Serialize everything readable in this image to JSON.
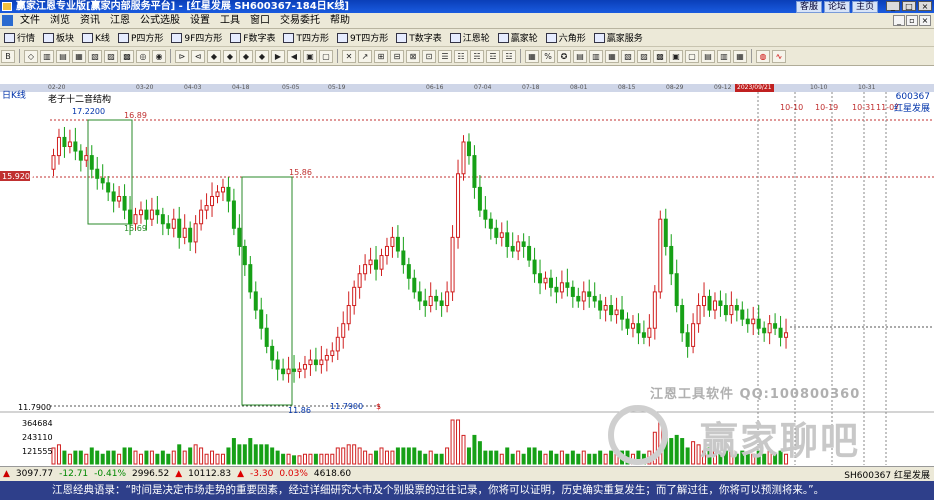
{
  "window": {
    "title": "赢家江恩专业版[赢家内部服务平台] - [红星发展  SH600367-184日K线]",
    "top_links": [
      "客服",
      "论坛",
      "主页"
    ]
  },
  "menu": [
    "文件",
    "浏览",
    "资讯",
    "江恩",
    "公式选股",
    "设置",
    "工具",
    "窗口",
    "交易委托",
    "帮助"
  ],
  "toolbar1": [
    "行情",
    "板块",
    "K线",
    "P四方形",
    "9F四方形",
    "F数字表",
    "T四方形",
    "9T四方形",
    "T数字表",
    "江恩轮",
    "赢家轮",
    "六角形",
    "赢家服务"
  ],
  "dates": [
    "02-20",
    "03-20",
    "04-03",
    "04-18",
    "05-05",
    "05-19",
    "06-16",
    "07-04",
    "07-18",
    "08-01",
    "08-15",
    "08-29",
    "09-12",
    "2023/09/21",
    "10-10",
    "10-31"
  ],
  "chart": {
    "period_label": "日K线",
    "indicator_label": "老子十二音结构",
    "stock_code": "600367",
    "stock_name": "红星发展",
    "high_tag": "17.2200",
    "level_1689": "16.89",
    "left_price": "15.9202",
    "level_1586": "15.86",
    "level_1569": "15.69",
    "low_left": "11.7900",
    "low_tag": "11.7900",
    "low_val": "11.86",
    "dollar": "$",
    "future_dates": [
      "10-10",
      "10-19",
      "10-31",
      "11-07"
    ],
    "volume_ticks": [
      "364684",
      "243110",
      "121555"
    ]
  },
  "chart_data": {
    "type": "candlestick",
    "title": "",
    "stock": "红星发展 600367",
    "high": 17.22,
    "low": 11.79,
    "levels": [
      16.89,
      15.86,
      15.69,
      15.9202
    ],
    "ylim": [
      11.0,
      18.0
    ],
    "volume_ticks": [
      364684,
      243110,
      121555
    ],
    "closes": [
      16.6,
      17.0,
      16.8,
      16.9,
      16.7,
      16.5,
      16.6,
      16.3,
      16.1,
      16.0,
      15.8,
      15.6,
      15.7,
      15.4,
      15.1,
      15.3,
      15.4,
      15.2,
      15.4,
      15.3,
      15.1,
      15.0,
      15.2,
      14.8,
      15.0,
      14.7,
      15.1,
      15.4,
      15.5,
      15.7,
      15.8,
      15.9,
      15.6,
      15.0,
      14.6,
      14.2,
      13.6,
      13.2,
      12.8,
      12.4,
      12.1,
      11.9,
      11.8,
      11.9,
      11.85,
      11.9,
      12.0,
      12.1,
      12.0,
      12.1,
      12.2,
      12.3,
      12.6,
      12.9,
      13.3,
      13.7,
      14.0,
      14.2,
      14.3,
      14.1,
      14.4,
      14.6,
      14.8,
      14.5,
      14.2,
      13.9,
      13.6,
      13.4,
      13.3,
      13.5,
      13.4,
      13.3,
      13.6,
      14.8,
      16.2,
      16.9,
      16.6,
      15.9,
      15.4,
      15.2,
      15.0,
      14.8,
      14.9,
      14.6,
      14.5,
      14.7,
      14.6,
      14.3,
      14.0,
      13.8,
      13.9,
      13.7,
      13.6,
      13.8,
      13.7,
      13.5,
      13.4,
      13.6,
      13.5,
      13.4,
      13.2,
      13.3,
      13.1,
      13.2,
      13.0,
      12.8,
      12.9,
      12.7,
      12.6,
      12.8,
      13.6,
      15.2,
      14.6,
      14.0,
      13.3,
      12.7,
      12.4,
      12.9,
      13.3,
      13.5,
      13.2,
      13.4,
      13.3,
      13.1,
      13.3,
      13.2,
      13.0,
      12.9,
      13.0,
      12.8,
      12.7,
      12.9,
      12.8,
      12.6,
      12.7
    ]
  },
  "status": {
    "items": [
      "3097.77",
      "-12.71",
      "-0.41%",
      "2996.52",
      "10112.83",
      "-3.30",
      "0.03%",
      "4618.60"
    ],
    "right": "SH600367 红星发展"
  },
  "watermark": {
    "line1": "江恩工具软件  QQ:100800360",
    "line2": "赢家聊吧"
  },
  "quote": "江恩经典语录：“时间是决定市场走势的重要因素，经过详细研究大市及个别股票的过往记录，你将可以证明，历史确实重复发生；而了解过往，你将可以预测将来。”。"
}
